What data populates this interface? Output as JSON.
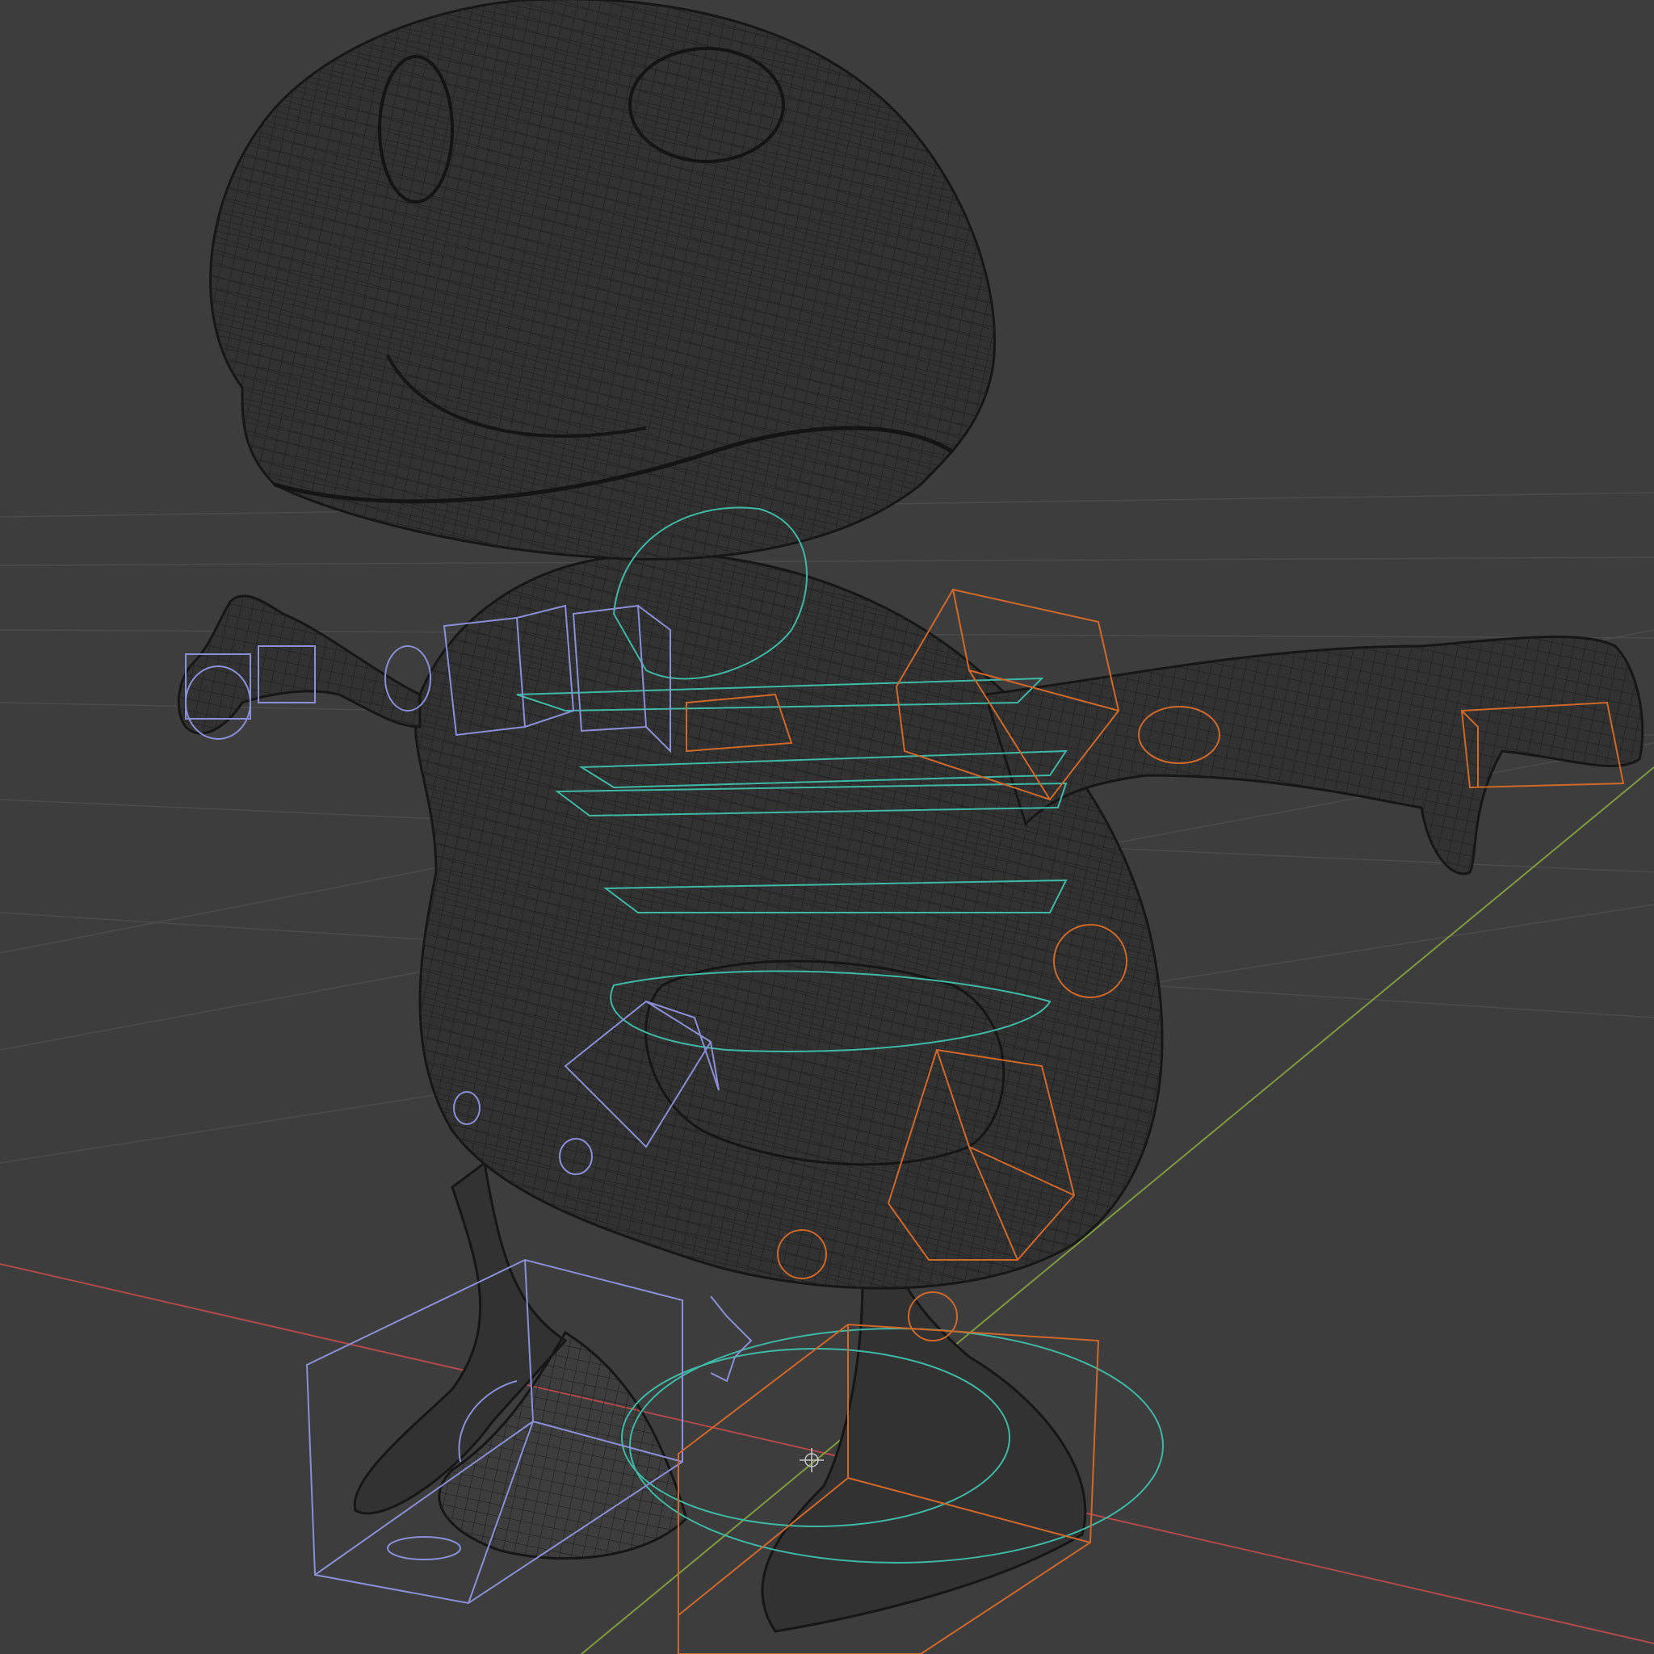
{
  "viewport": {
    "mode": "wireframe",
    "background_color": "#3d3d3d"
  },
  "colors": {
    "grid": "#4a4a4a",
    "axis_x": "#b04a4a",
    "axis_y": "#7f9a3f",
    "mesh_outline": "#1e1e1e",
    "mesh_fill": "#323232",
    "mesh_wire": "#1a1a1a",
    "rig_left": "#8a8fd6",
    "rig_right": "#d0682a",
    "rig_center": "#3fb8a6"
  },
  "scene": {
    "object": "character-mesh",
    "armature": "character-rig"
  }
}
